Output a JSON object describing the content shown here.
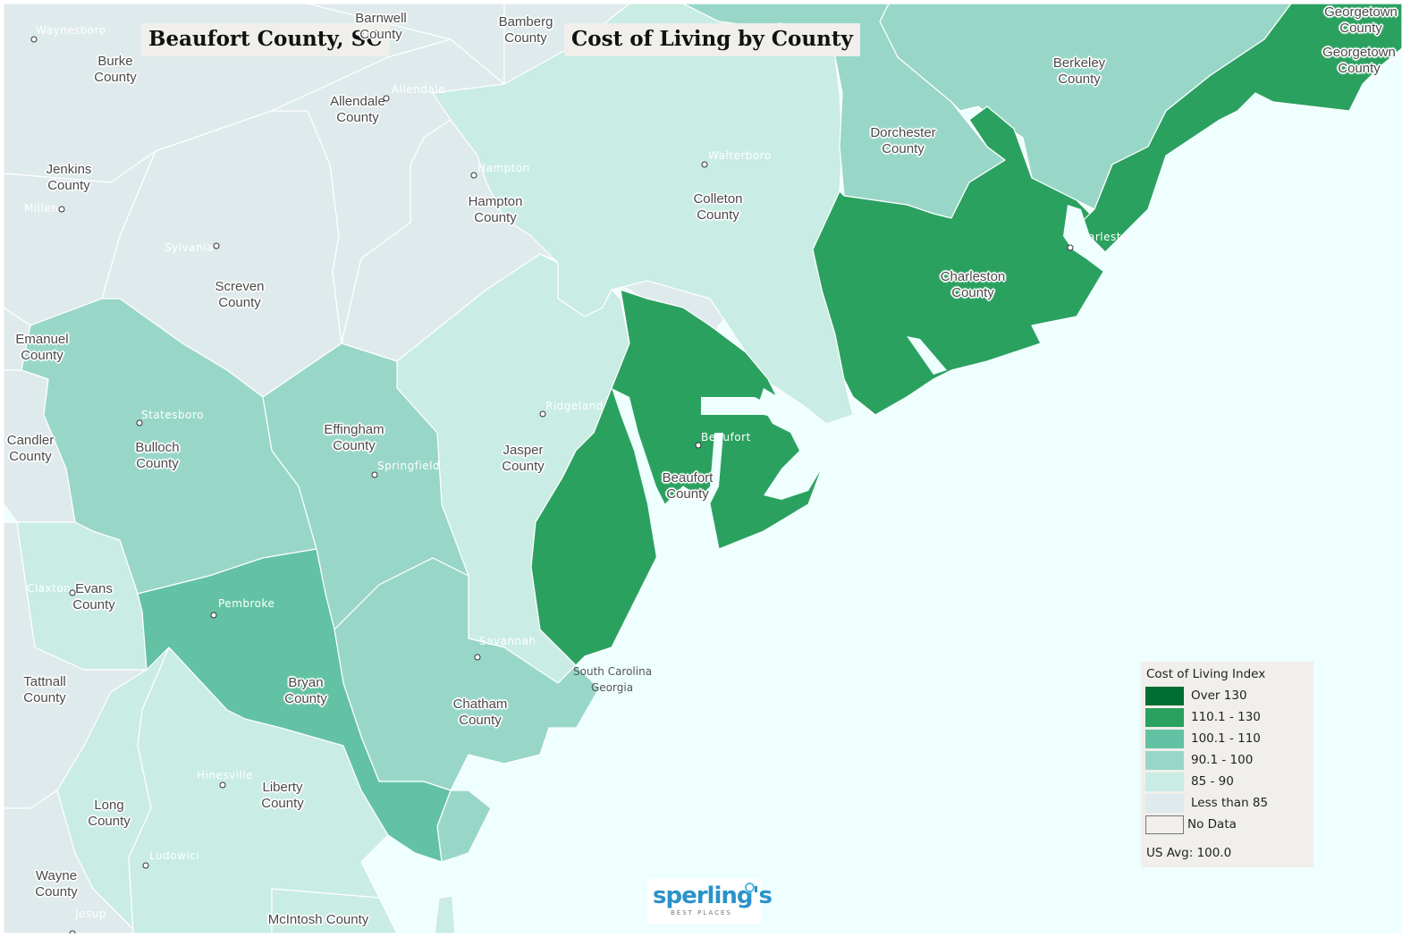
{
  "titles": {
    "location": "Beaufort County, SC",
    "map_title": "Cost of Living by County"
  },
  "legend": {
    "title": "Cost of Living Index",
    "items": [
      {
        "label": "Over 130",
        "color": "#006e30"
      },
      {
        "label": "110.1 - 130",
        "color": "#2ba160"
      },
      {
        "label": "100.1 - 110",
        "color": "#63c2a4"
      },
      {
        "label": "90.1 - 100",
        "color": "#98d7c8"
      },
      {
        "label": "85 - 90",
        "color": "#c9ece4"
      },
      {
        "label": "Less than 85",
        "color": "#dfeaec"
      },
      {
        "label": "No Data",
        "color": "#f0efeb"
      }
    ],
    "us_avg": "US Avg: 100.0"
  },
  "colors": {
    "water": "#effefe",
    "over_130": "#006e30",
    "t110_130": "#2ba160",
    "t100_110": "#63c2a4",
    "t90_100": "#98d7c8",
    "t85_90": "#c9ece4",
    "lt85": "#dfeaec"
  },
  "counties": [
    {
      "name": "Beaufort County",
      "label": "Beaufort\nCounty",
      "bracket": "110.1 - 130"
    },
    {
      "name": "Charleston County",
      "label": "Charleston\nCounty",
      "bracket": "110.1 - 130"
    },
    {
      "name": "Georgetown County",
      "label": "Georgetown\nCounty",
      "bracket": "110.1 - 130"
    },
    {
      "name": "Bryan County",
      "label": "Bryan\nCounty",
      "bracket": "100.1 - 110"
    },
    {
      "name": "Berkeley County",
      "label": "Berkeley\nCounty",
      "bracket": "90.1 - 100"
    },
    {
      "name": "Dorchester County",
      "label": "Dorchester\nCounty",
      "bracket": "90.1 - 100"
    },
    {
      "name": "Bulloch County",
      "label": "Bulloch\nCounty",
      "bracket": "90.1 - 100"
    },
    {
      "name": "Effingham County",
      "label": "Effingham\nCounty",
      "bracket": "90.1 - 100"
    },
    {
      "name": "Chatham County",
      "label": "Chatham\nCounty",
      "bracket": "90.1 - 100"
    },
    {
      "name": "Colleton County",
      "label": "Colleton\nCounty",
      "bracket": "85 - 90"
    },
    {
      "name": "Jasper County",
      "label": "Jasper\nCounty",
      "bracket": "85 - 90"
    },
    {
      "name": "Evans County",
      "label": "Evans\nCounty",
      "bracket": "85 - 90"
    },
    {
      "name": "Liberty County",
      "label": "Liberty\nCounty",
      "bracket": "85 - 90"
    },
    {
      "name": "Long County",
      "label": "Long\nCounty",
      "bracket": "85 - 90"
    },
    {
      "name": "McIntosh County",
      "label": "McIntosh County",
      "bracket": "85 - 90"
    },
    {
      "name": "Hampton County",
      "label": "Hampton\nCounty",
      "bracket": "Less than 85"
    },
    {
      "name": "Allendale County",
      "label": "Allendale\nCounty",
      "bracket": "Less than 85"
    },
    {
      "name": "Screven County",
      "label": "Screven\nCounty",
      "bracket": "Less than 85"
    },
    {
      "name": "Jenkins County",
      "label": "Jenkins\nCounty",
      "bracket": "Less than 85"
    },
    {
      "name": "Burke County",
      "label": "Burke\nCounty",
      "bracket": "Less than 85"
    },
    {
      "name": "Barnwell County",
      "label": "Barnwell\nCounty",
      "bracket": "Less than 85"
    },
    {
      "name": "Bamberg County",
      "label": "Bamberg\nCounty",
      "bracket": "Less than 85"
    },
    {
      "name": "Emanuel County",
      "label": "Emanuel\nCounty",
      "bracket": "Less than 85"
    },
    {
      "name": "Candler County",
      "label": "Candler\nCounty",
      "bracket": "Less than 85"
    },
    {
      "name": "Tattnall County",
      "label": "Tattnall\nCounty",
      "bracket": "Less than 85"
    },
    {
      "name": "Wayne County",
      "label": "Wayne\nCounty",
      "bracket": "Less than 85"
    }
  ],
  "cities": [
    "Waynesboro",
    "Allendale",
    "Millen",
    "Sylvania",
    "Hampton",
    "Walterboro",
    "Statesboro",
    "Springfield",
    "Ridgeland",
    "Beaufort",
    "Charleston",
    "Claxton",
    "Pembroke",
    "Savannah",
    "Hinesville",
    "Ludowici",
    "Jesup"
  ],
  "state_labels": [
    "South Carolina",
    "Georgia"
  ],
  "logo": {
    "main": "sperling's",
    "sub": "BEST PLACES"
  }
}
